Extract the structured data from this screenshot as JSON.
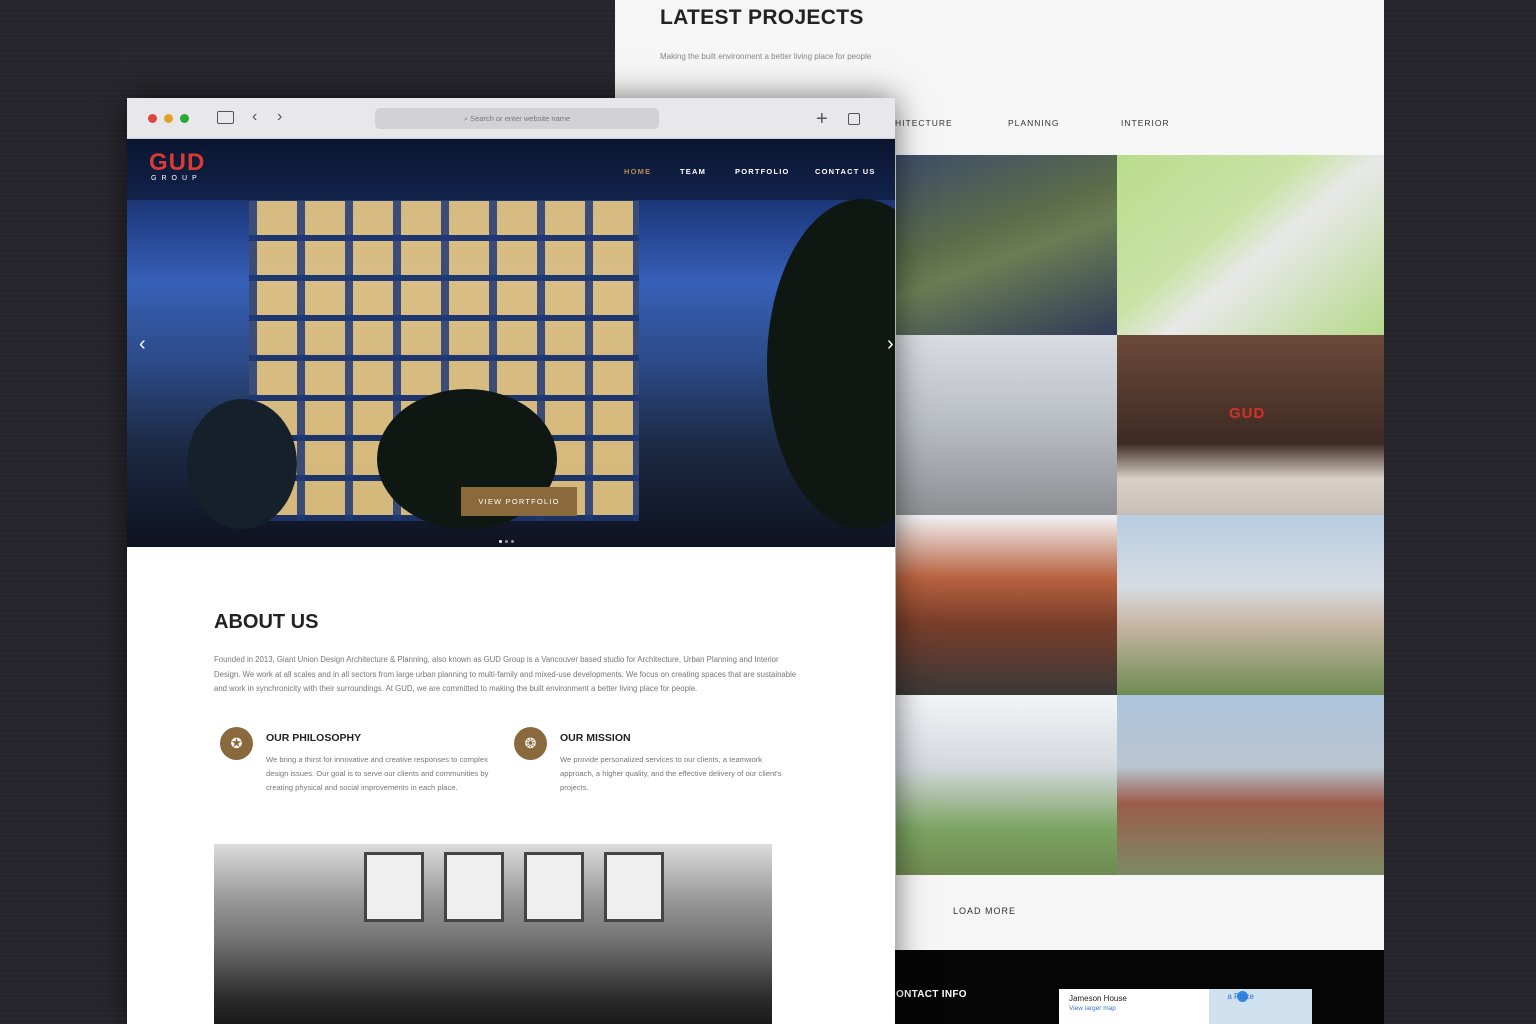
{
  "back": {
    "title": "LATEST PROJECTS",
    "subtitle": "Making the built environment a better living place for people",
    "filters": [
      "HITECTURE",
      "PLANNING",
      "INTERIOR"
    ],
    "sign_text": "GUD",
    "load_more": "LOAD MORE",
    "contact_title": "ONTACT INFO",
    "map": {
      "name": "Jameson House",
      "link": "View larger map",
      "place": "a Place"
    }
  },
  "browser": {
    "url_placeholder": "Search or enter website name",
    "icons": [
      "sidebar-icon",
      "back-icon",
      "forward-icon",
      "new-tab-icon",
      "tabs-icon"
    ]
  },
  "site": {
    "logo_main": "GUD",
    "logo_sub": "GROUP",
    "nav": [
      "HOME",
      "TEAM",
      "PORTFOLIO",
      "CONTACT US"
    ],
    "accent": "#8a6a3c",
    "brand_red": "#d93a33",
    "hero_button": "VIEW PORTFOLIO",
    "about_title": "ABOUT US",
    "about_body": "Founded in 2013, Giant Union Design Architecture & Planning, also known as GUD Group is a Vancouver based studio for Architecture, Urban Planning and Interior Design. We work at all scales and in all sectors from large urban planning to multi-family and mixed-use developments. We focus on creating spaces that are sustainable and work in synchronicity with their surroundings. At GUD, we are committed to making the built environment a better living place for people.",
    "philosophy_title": "OUR PHILOSOPHY",
    "philosophy_body": "We bring a thirst for innovative and creative responses to complex design issues. Our goal is to serve our clients and communities by creating physical and social improvements in each place.",
    "mission_title": "OUR MISSION",
    "mission_body": "We provide personalized services to our clients, a teamwork approach, a higher quality, and the effective delivery of our client's projects."
  }
}
